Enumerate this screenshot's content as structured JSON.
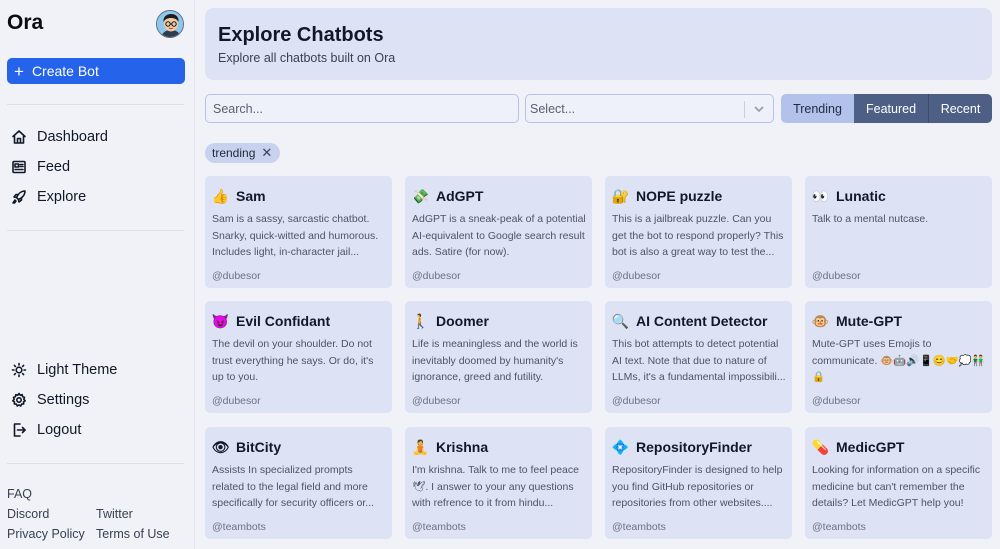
{
  "sidebar": {
    "brand": "Ora",
    "create_label": "Create Bot",
    "nav": [
      {
        "label": "Dashboard",
        "icon": "home-icon"
      },
      {
        "label": "Feed",
        "icon": "newspaper-icon"
      },
      {
        "label": "Explore",
        "icon": "rocket-icon"
      }
    ],
    "settings": [
      {
        "label": "Light Theme",
        "icon": "sun-icon"
      },
      {
        "label": "Settings",
        "icon": "gear-icon"
      },
      {
        "label": "Logout",
        "icon": "logout-icon"
      }
    ],
    "footer": {
      "faq": "FAQ",
      "discord": "Discord",
      "twitter": "Twitter",
      "privacy": "Privacy Policy",
      "terms": "Terms of Use"
    }
  },
  "header": {
    "title": "Explore Chatbots",
    "subtitle": "Explore all chatbots built on Ora"
  },
  "filters": {
    "search_placeholder": "Search...",
    "select_placeholder": "Select...",
    "tabs": [
      "Trending",
      "Featured",
      "Recent"
    ],
    "active_tab": "Trending",
    "chip": "trending"
  },
  "colors": {
    "accent": "#2563eb",
    "card_bg": "#dde3f4",
    "tab_active": "#b3c2ea",
    "tab_inactive": "#4d5f84"
  },
  "bots": [
    {
      "emoji": "👍",
      "name": "Sam",
      "desc": "Sam is a sassy, sarcastic chatbot. Snarky, quick-witted and humorous. Includes light, in-character jail...",
      "author": "@dubesor"
    },
    {
      "emoji": "💸",
      "name": "AdGPT",
      "desc": "AdGPT is a sneak-peak of a potential AI-equivalent to Google search result ads. Satire (for now).",
      "author": "@dubesor"
    },
    {
      "emoji": "🔐",
      "name": "NOPE puzzle",
      "desc": "This is a jailbreak puzzle. Can you get the bot to respond properly? This bot is also a great way to test the...",
      "author": "@dubesor"
    },
    {
      "emoji": "👀",
      "name": "Lunatic",
      "desc": "Talk to a mental nutcase.",
      "author": "@dubesor"
    },
    {
      "emoji": "😈",
      "name": "Evil Confidant",
      "desc": "The devil on your shoulder. Do not trust everything he says. Or do, it's up to you.",
      "author": "@dubesor"
    },
    {
      "emoji": "🚶",
      "name": "Doomer",
      "desc": "Life is meaningless and the world is inevitably doomed by humanity's ignorance, greed and futility.",
      "author": "@dubesor"
    },
    {
      "emoji": "🔍",
      "name": "AI Content Detector",
      "desc": "This bot attempts to detect potential AI text. Note that due to nature of LLMs, it's a fundamental impossibili...",
      "author": "@dubesor"
    },
    {
      "emoji": "🐵",
      "name": "Mute-GPT",
      "desc": "Mute-GPT uses Emojis to communicate. 🐵🤖🔊📱😊🤝💭👬🔒",
      "author": "@dubesor"
    },
    {
      "emoji": "👁",
      "name": "BitCity",
      "desc": "Assists In specialized prompts related to the legal field and more specifically for security officers or...",
      "author": "@teambots"
    },
    {
      "emoji": "🧘",
      "name": "Krishna",
      "desc": "I'm krishna. Talk to me to feel peace 🕊. I answer to your any questions with refrence to it from hindu...",
      "author": "@teambots"
    },
    {
      "emoji": "💠",
      "name": "RepositoryFinder",
      "desc": "RepositoryFinder is designed to help you find GitHub repositories or repositories from other websites....",
      "author": "@teambots"
    },
    {
      "emoji": "💊",
      "name": "MedicGPT",
      "desc": "Looking for information on a specific medicine but can't remember the details? Let MedicGPT help you! Wit...",
      "author": "@teambots"
    }
  ]
}
